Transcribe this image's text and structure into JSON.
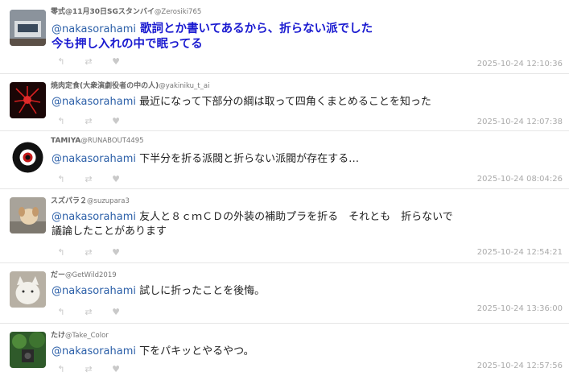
{
  "replies": [
    {
      "display_name": "零式@11月30日SGスタンバイ",
      "handle": "@Zerosiki765",
      "mention": "@nakasorahami",
      "text": " 歌詞とか書いてあるから、折らない派でした",
      "text2": "今も押し入れの中で眠ってる",
      "timestamp": "2025-10-24 12:10:36",
      "avatar": "desk-device-avatar"
    },
    {
      "display_name": "焼肉定食(大衆演劇役者の中の人)",
      "handle": "@yakiniku_t_ai",
      "mention": "@nakasorahami",
      "text": " 最近になって下部分の綱は取って四角くまとめることを知った",
      "timestamp": "2025-10-24 12:07:38",
      "avatar": "red-flower-avatar"
    },
    {
      "display_name": "TAMIYA",
      "handle": "@RUNABOUT4495",
      "mention": "@nakasorahami",
      "text": " 下半分を折る派閥と折らない派閥が存在する…",
      "timestamp": "2025-10-24 08:04:26",
      "avatar": "round-logo-avatar"
    },
    {
      "display_name": "スズパラ２",
      "handle": "@suzupara3",
      "mention": "@nakasorahami",
      "text": " 友人と８ｃｍＣＤの外装の補助プラを折る　それとも　折らないで",
      "text2": "議論したことがあります",
      "timestamp": "2025-10-24 12:54:21",
      "avatar": "dog-avatar"
    },
    {
      "display_name": "だー",
      "handle": "@GetWild2019",
      "mention": "@nakasorahami",
      "text": " 試しに折ったことを後悔。",
      "timestamp": "2025-10-24 13:36:00",
      "avatar": "white-cat-avatar"
    },
    {
      "display_name": "たけ",
      "handle": "@Take_Color",
      "mention": "@nakasorahami",
      "text": " 下をパキッとやるやつ。",
      "timestamp": "2025-10-24 12:57:56",
      "avatar": "green-photo-avatar"
    }
  ],
  "icons": [
    "reply-icon",
    "retweet-icon",
    "like-icon"
  ],
  "colors": {
    "mention": "#2b5fa8",
    "highlight_text": "#1a1ad0",
    "timestamp": "#aaaaaa",
    "action_icon": "#c9c9c9"
  }
}
